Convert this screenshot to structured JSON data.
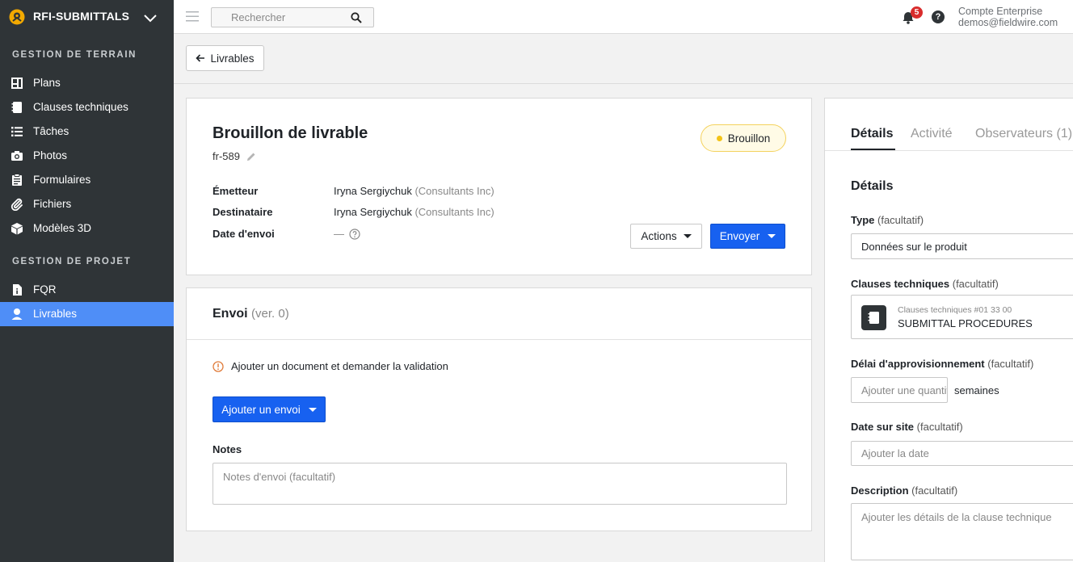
{
  "project": {
    "name": "RFI-SUBMITTALS"
  },
  "sidebar": {
    "section_field": "GESTION DE TERRAIN",
    "section_project": "GESTION DE PROJET",
    "items": [
      {
        "label": "Plans",
        "icon": "plans-icon"
      },
      {
        "label": "Clauses techniques",
        "icon": "specs-icon"
      },
      {
        "label": "Tâches",
        "icon": "tasks-icon"
      },
      {
        "label": "Photos",
        "icon": "camera-icon"
      },
      {
        "label": "Formulaires",
        "icon": "forms-icon"
      },
      {
        "label": "Fichiers",
        "icon": "paperclip-icon"
      },
      {
        "label": "Modèles 3D",
        "icon": "cube-icon"
      },
      {
        "label": "FQR",
        "icon": "rfi-icon"
      },
      {
        "label": "Livrables",
        "icon": "submittal-icon",
        "active": true
      }
    ]
  },
  "topbar": {
    "search_placeholder": "Rechercher",
    "notification_count": "5",
    "help": "?",
    "account_name": "Compte Enterprise",
    "account_email": "demos@fieldwire.com"
  },
  "subheader": {
    "back_label": "Livrables"
  },
  "submittal": {
    "title": "Brouillon de livrable",
    "code": "fr-589",
    "status": "Brouillon",
    "status_color": "#f3c317",
    "issuer_label": "Émetteur",
    "issuer_name": "Iryna Sergiychuk",
    "issuer_org": "(Consultants Inc)",
    "recipient_label": "Destinataire",
    "recipient_name": "Iryna Sergiychuk",
    "recipient_org": "(Consultants Inc)",
    "send_date_label": "Date d'envoi",
    "send_date_value": "—",
    "actions_label": "Actions",
    "send_label": "Envoyer"
  },
  "envoi": {
    "title": "Envoi",
    "version": "(ver. 0)",
    "warning": "Ajouter un document et demander la validation",
    "add_button": "Ajouter un envoi",
    "notes_label": "Notes",
    "notes_placeholder": "Notes d'envoi (facultatif)"
  },
  "details": {
    "tabs": [
      "Détails",
      "Activité",
      "Observateurs (1)"
    ],
    "heading": "Détails",
    "optional": "(facultatif)",
    "type_label": "Type",
    "type_value": "Données sur le produit",
    "spec_label": "Clauses techniques",
    "spec_ref": "Clauses techniques #01 33 00",
    "spec_name": "SUBMITTAL PROCEDURES",
    "lead_label": "Délai d'approvisionnement",
    "lead_placeholder": "Ajouter une quantité",
    "lead_unit": "semaines",
    "site_date_label": "Date sur site",
    "site_date_placeholder": "Ajouter la date",
    "desc_label": "Description",
    "desc_placeholder": "Ajouter les détails de la clause technique"
  },
  "colors": {
    "sidebar": "#2f3437",
    "active": "#4f8ef7",
    "primary": "#1761f0",
    "badge": "#d92c2c"
  }
}
